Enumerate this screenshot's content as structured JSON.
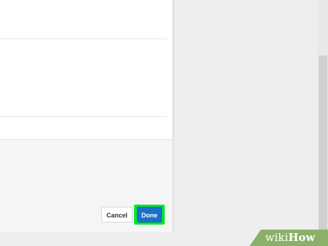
{
  "dialog": {
    "buttons": {
      "cancel_label": "Cancel",
      "done_label": "Done"
    }
  },
  "watermark": {
    "prefix": "wiki",
    "brand": "How"
  },
  "colors": {
    "highlight": "#00e62e",
    "primary_button": "#1a6fc9",
    "watermark_band": "#8cb06a"
  }
}
